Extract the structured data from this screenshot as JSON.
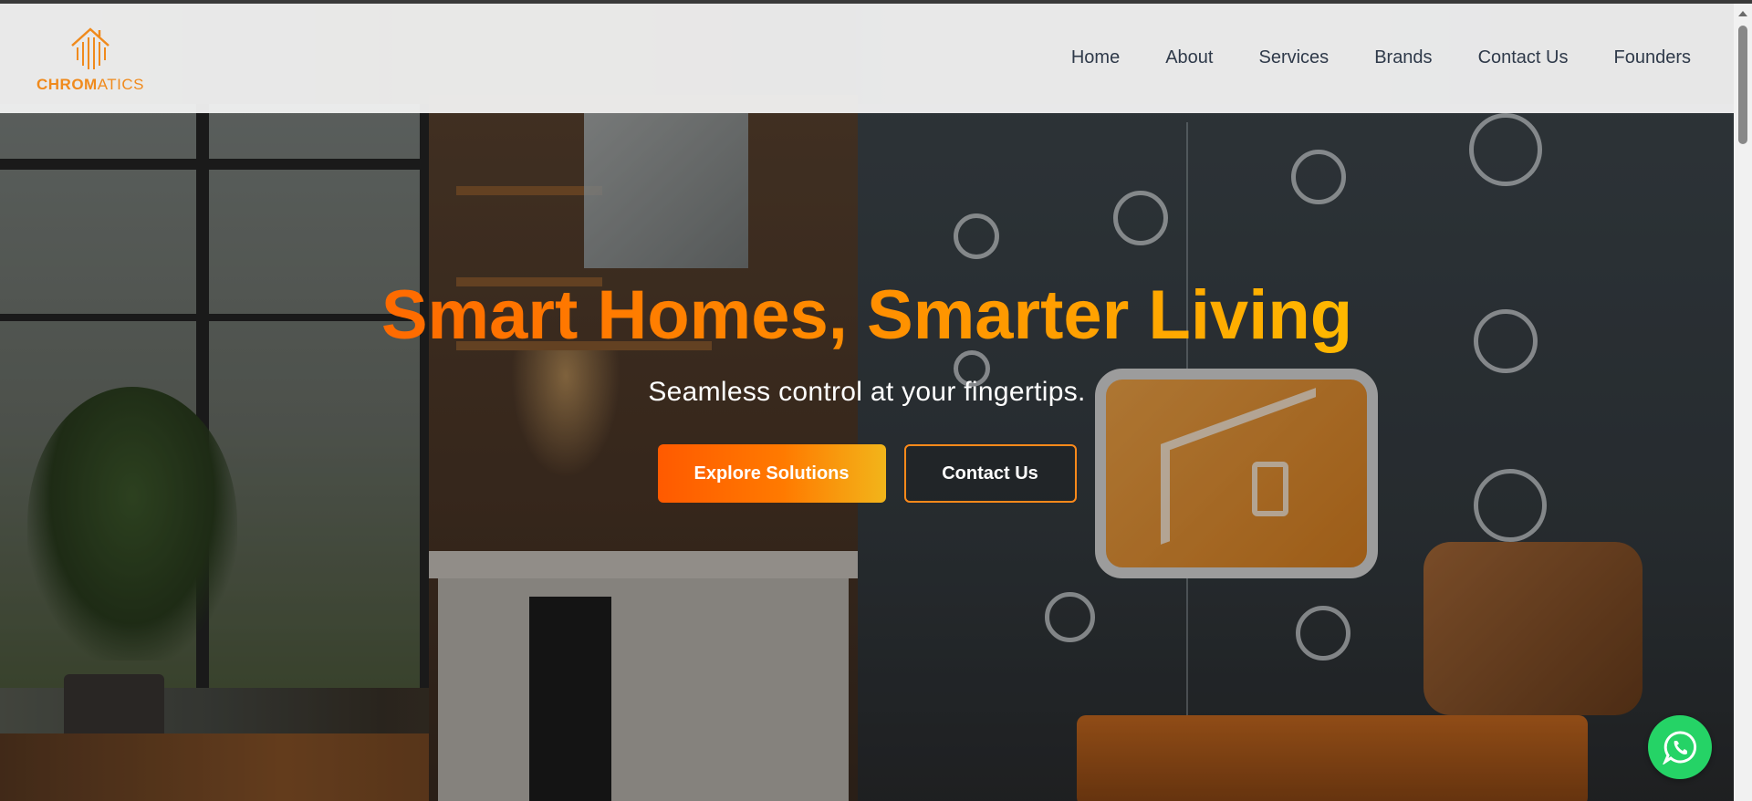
{
  "brand": {
    "name_part1": "CHROM",
    "name_part2": "ATICS",
    "accent_color": "#f08a1c"
  },
  "nav": {
    "items": [
      {
        "label": "Home"
      },
      {
        "label": "About"
      },
      {
        "label": "Services"
      },
      {
        "label": "Brands"
      },
      {
        "label": "Contact Us"
      },
      {
        "label": "Founders"
      }
    ]
  },
  "hero": {
    "headline": "Smart Homes, Smarter Living",
    "subtitle": "Seamless control at your fingertips.",
    "primary_cta": "Explore Solutions",
    "secondary_cta": "Contact Us",
    "gradient_start": "#ff6a00",
    "gradient_end": "#ffb800"
  },
  "floating": {
    "whatsapp_icon": "whatsapp-icon",
    "whatsapp_color": "#25d366"
  }
}
